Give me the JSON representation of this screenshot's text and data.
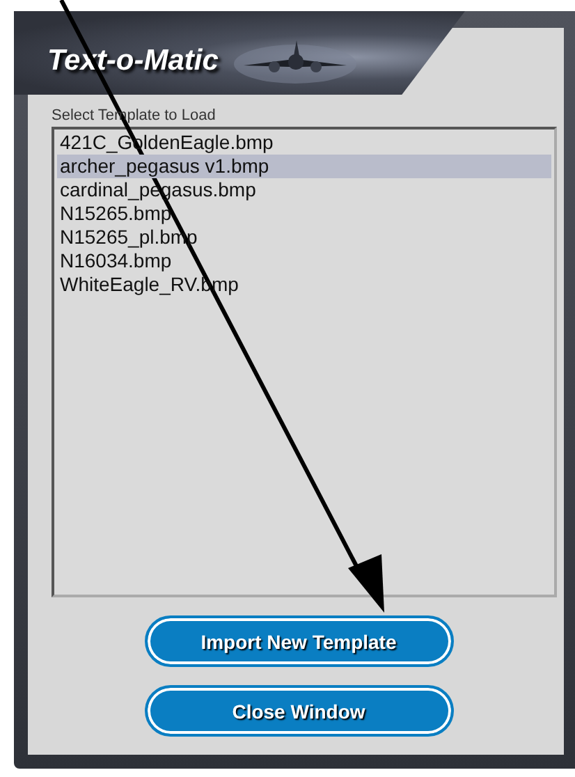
{
  "window": {
    "title": "Text-o-Matic"
  },
  "template_list": {
    "label": "Select Template to Load",
    "items": [
      {
        "name": "421C_GoldenEagle.bmp",
        "selected": false
      },
      {
        "name": "archer_pegasus v1.bmp",
        "selected": true
      },
      {
        "name": "cardinal_pegasus.bmp",
        "selected": false
      },
      {
        "name": "N15265.bmp",
        "selected": false
      },
      {
        "name": "N15265_pl.bmp",
        "selected": false
      },
      {
        "name": "N16034.bmp",
        "selected": false
      },
      {
        "name": "WhiteEagle_RV.bmp",
        "selected": false
      }
    ]
  },
  "buttons": [
    "Import New Template",
    "Close Window"
  ]
}
